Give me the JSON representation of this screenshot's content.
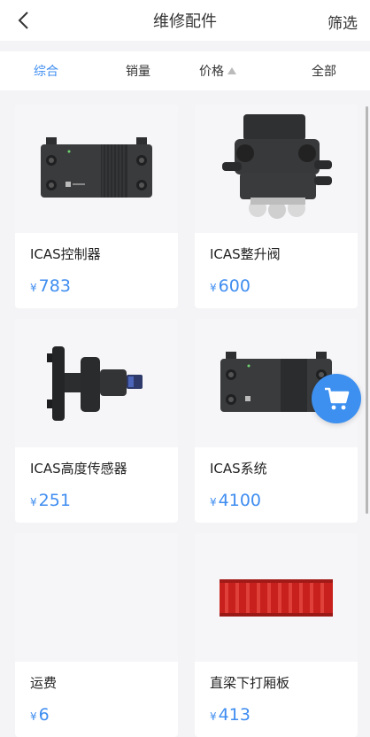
{
  "header": {
    "title": "维修配件",
    "filter_label": "筛选"
  },
  "sort_tabs": [
    {
      "label": "综合",
      "active": true
    },
    {
      "label": "销量",
      "active": false
    },
    {
      "label": "价格",
      "active": false
    },
    {
      "label": "全部",
      "active": false
    }
  ],
  "products": [
    {
      "name": "ICAS控制器",
      "currency": "¥",
      "price": "783",
      "icon": "controller-image"
    },
    {
      "name": "ICAS整升阀",
      "currency": "¥",
      "price": "600",
      "icon": "valve-image"
    },
    {
      "name": "ICAS高度传感器",
      "currency": "¥",
      "price": "251",
      "icon": "sensor-image"
    },
    {
      "name": "ICAS系统",
      "currency": "¥",
      "price": "4100",
      "icon": "system-image"
    },
    {
      "name": "运费",
      "currency": "¥",
      "price": "6",
      "icon": ""
    },
    {
      "name": "直梁下打厢板",
      "currency": "¥",
      "price": "413",
      "icon": "panel-image"
    }
  ],
  "colors": {
    "accent": "#3f8df0",
    "panel_red": "#c8201c"
  }
}
